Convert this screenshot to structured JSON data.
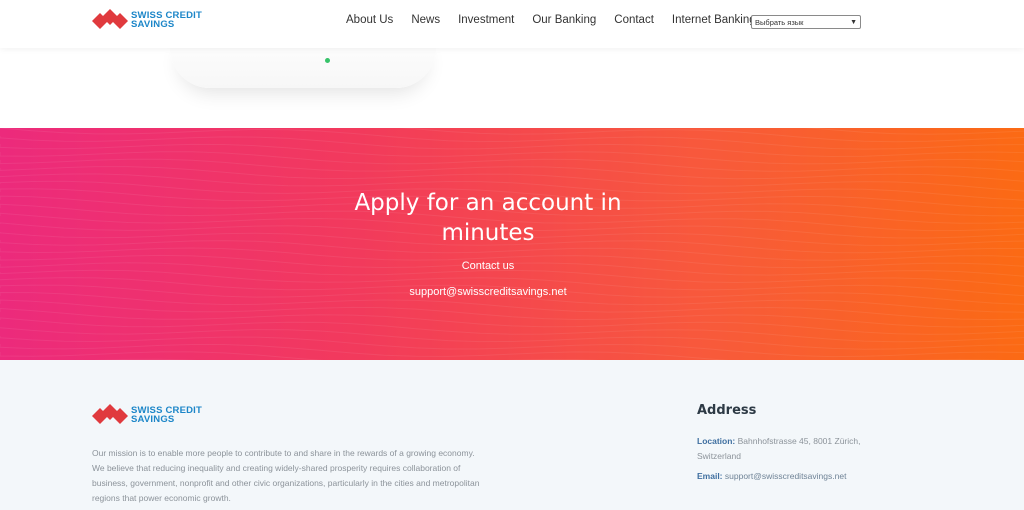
{
  "brand": {
    "name_line1": "SWISS CREDIT",
    "name_line2": "SAVINGS",
    "colors": {
      "logo_red": "#e03a3e",
      "logo_blue": "#1c86c8"
    }
  },
  "nav": {
    "items": [
      "About Us",
      "News",
      "Investment",
      "Our Banking",
      "Contact",
      "Internet Banking"
    ],
    "language_select": "Выбрать язык"
  },
  "cta": {
    "title": "Apply for an account in minutes",
    "contact_label": "Contact us",
    "email": "support@swisscreditsavings.net",
    "gradient": [
      "#ec2a7c",
      "#fb6a14"
    ]
  },
  "footer": {
    "mission": "Our mission is to enable more people to contribute to and share in the rewards of a growing economy. We believe that reducing inequality and creating widely-shared prosperity requires collaboration of business, government, nonprofit and other civic organizations, particularly in the cities and metropolitan regions that power economic growth.",
    "address_title": "Address",
    "location_label": "Location:",
    "location_value": "Bahnhofstrasse 45, 8001 Zürich, Switzerland",
    "email_label": "Email:",
    "email_value": "support@swisscreditsavings.net"
  }
}
